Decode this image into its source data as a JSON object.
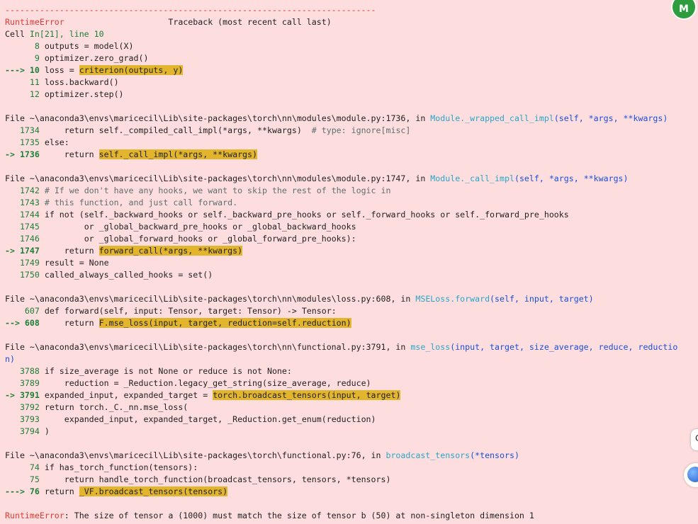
{
  "separator": "---------------------------------------------------------------------------",
  "header": {
    "error_type": "RuntimeError",
    "traceback_label": "Traceback (most recent call last)",
    "cell_prefix": "Cell ",
    "cell_ref": "In[21], line 10"
  },
  "frames": [
    {
      "file_line": null,
      "lines": [
        {
          "prefix": "      ",
          "num": "8",
          "code": "outputs = model(X)"
        },
        {
          "prefix": "      ",
          "num": "9",
          "code": "optimizer.zero_grad()"
        },
        {
          "prefix": "---> ",
          "num": "10",
          "pre": "loss = ",
          "hl": "criterion(outputs, y)",
          "post": ""
        },
        {
          "prefix": "     ",
          "num": "11",
          "code": "loss.backward()"
        },
        {
          "prefix": "     ",
          "num": "12",
          "code": "optimizer.step()"
        }
      ]
    }
  ],
  "f1": {
    "file": "File ~\\anaconda3\\envs\\maricecil\\Lib\\site-packages\\torch\\nn\\modules\\module.py:1736",
    "in": ", in ",
    "func": "Module._wrapped_call_impl",
    "args": "(self, *args, **kwargs)",
    "l1": {
      "num": "1734",
      "code": "    return self._compiled_call_impl(*args, **kwargs)  ",
      "comment": "# type: ignore[misc]"
    },
    "l2": {
      "num": "1735",
      "code": "else:"
    },
    "l3": {
      "num": "1736",
      "pre": "    return ",
      "hl": "self._call_impl(*args, **kwargs)"
    }
  },
  "f2": {
    "file": "File ~\\anaconda3\\envs\\maricecil\\Lib\\site-packages\\torch\\nn\\modules\\module.py:1747",
    "in": ", in ",
    "func": "Module._call_impl",
    "args": "(self, *args, **kwargs)",
    "l1": {
      "num": "1742",
      "comment": "# If we don't have any hooks, we want to skip the rest of the logic in"
    },
    "l2": {
      "num": "1743",
      "comment": "# this function, and just call forward."
    },
    "l3": {
      "num": "1744",
      "code": "if not (self._backward_hooks or self._backward_pre_hooks or self._forward_hooks or self._forward_pre_hooks"
    },
    "l4": {
      "num": "1745",
      "code": "        or _global_backward_pre_hooks or _global_backward_hooks"
    },
    "l5": {
      "num": "1746",
      "code": "        or _global_forward_hooks or _global_forward_pre_hooks):"
    },
    "l6": {
      "num": "1747",
      "pre": "    return ",
      "hl": "forward_call(*args, **kwargs)"
    },
    "l7": {
      "num": "1749",
      "code": "result = None"
    },
    "l8": {
      "num": "1750",
      "code": "called_always_called_hooks = set()"
    }
  },
  "f3": {
    "file": "File ~\\anaconda3\\envs\\maricecil\\Lib\\site-packages\\torch\\nn\\modules\\loss.py:608",
    "in": ", in ",
    "func": "MSELoss.forward",
    "args": "(self, input, target)",
    "l1": {
      "num": "607",
      "code": "def forward(self, input: Tensor, target: Tensor) -> Tensor:"
    },
    "l2": {
      "num": "608",
      "pre": "    return ",
      "hl": "F.mse_loss(input, target, reduction=self.reduction)"
    }
  },
  "f4": {
    "file": "File ~\\anaconda3\\envs\\maricecil\\Lib\\site-packages\\torch\\nn\\functional.py:3791",
    "in": ", in ",
    "func": "mse_loss",
    "args": "(input, target, size_average, reduce, reductio",
    "wrap": "n)",
    "l1": {
      "num": "3788",
      "code": "if size_average is not None or reduce is not None:"
    },
    "l2": {
      "num": "3789",
      "code": "    reduction = _Reduction.legacy_get_string(size_average, reduce)"
    },
    "l3": {
      "num": "3791",
      "pre": "expanded_input, expanded_target = ",
      "hl": "torch.broadcast_tensors(input, target)"
    },
    "l4": {
      "num": "3792",
      "code": "return torch._C._nn.mse_loss("
    },
    "l5": {
      "num": "3793",
      "code": "    expanded_input, expanded_target, _Reduction.get_enum(reduction)"
    },
    "l6": {
      "num": "3794",
      "code": ")"
    }
  },
  "f5": {
    "file": "File ~\\anaconda3\\envs\\maricecil\\Lib\\site-packages\\torch\\functional.py:76",
    "in": ", in ",
    "func": "broadcast_tensors",
    "args": "(*tensors)",
    "l1": {
      "num": "74",
      "code": "if has_torch_function(tensors):"
    },
    "l2": {
      "num": "75",
      "code": "    return handle_torch_function(broadcast_tensors, tensors, *tensors)"
    },
    "l3": {
      "num": "76",
      "pre": "return ",
      "hl": "_VF.broadcast_tensors(tensors)"
    }
  },
  "final": {
    "error_type": "RuntimeError",
    "message": ": The size of tensor a (1000) must match the size of tensor b (50) at non-singleton dimension 1"
  },
  "arrows": {
    "short": "-> ",
    "long": "---> ",
    "mid": "--> "
  },
  "extension": {
    "badge": "M",
    "mid_char": "C"
  }
}
